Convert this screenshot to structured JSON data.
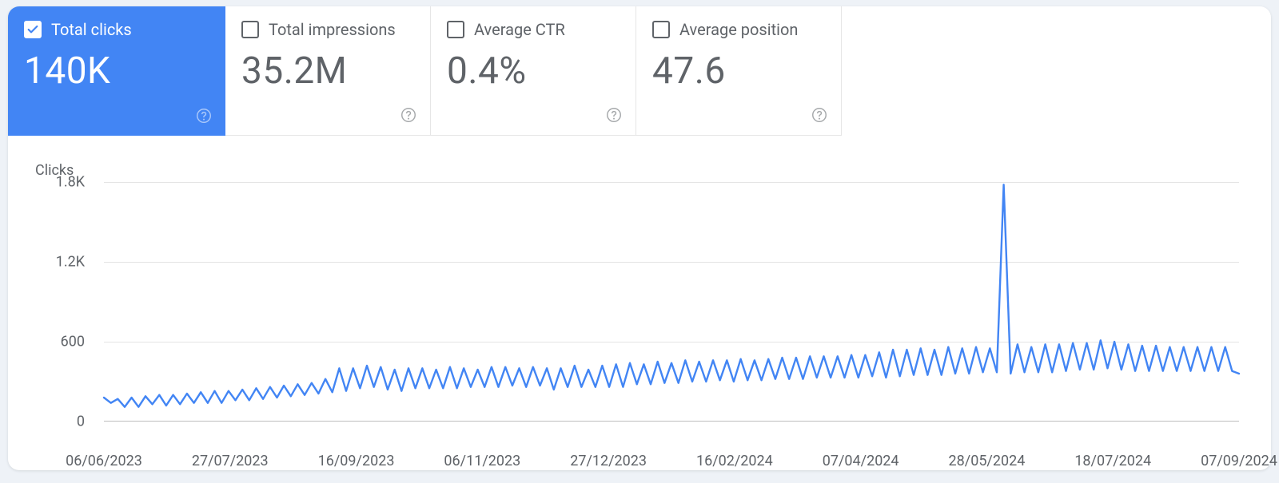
{
  "metrics": [
    {
      "label": "Total clicks",
      "value": "140K",
      "active": true
    },
    {
      "label": "Total impressions",
      "value": "35.2M",
      "active": false
    },
    {
      "label": "Average CTR",
      "value": "0.4%",
      "active": false
    },
    {
      "label": "Average position",
      "value": "47.6",
      "active": false
    }
  ],
  "chart_data": {
    "type": "line",
    "title": "Clicks",
    "ylabel": "",
    "ylim": [
      0,
      1800
    ],
    "y_ticks": [
      0,
      600,
      1200,
      1800
    ],
    "y_tick_labels": [
      "0",
      "600",
      "1.2K",
      "1.8K"
    ],
    "x_tick_labels": [
      "06/06/2023",
      "27/07/2023",
      "16/09/2023",
      "06/11/2023",
      "27/12/2023",
      "16/02/2024",
      "07/04/2024",
      "28/05/2024",
      "18/07/2024",
      "07/09/2024"
    ],
    "series": [
      {
        "name": "Clicks",
        "color": "#4285f4",
        "values": [
          180,
          140,
          170,
          110,
          180,
          110,
          190,
          130,
          200,
          120,
          200,
          130,
          210,
          140,
          220,
          140,
          230,
          140,
          230,
          160,
          240,
          160,
          250,
          170,
          260,
          180,
          270,
          190,
          280,
          200,
          290,
          210,
          320,
          220,
          400,
          230,
          400,
          250,
          420,
          260,
          410,
          240,
          390,
          230,
          400,
          250,
          400,
          250,
          390,
          250,
          410,
          250,
          400,
          260,
          390,
          260,
          410,
          260,
          410,
          270,
          400,
          260,
          410,
          270,
          400,
          240,
          400,
          260,
          420,
          260,
          390,
          260,
          420,
          260,
          430,
          260,
          440,
          280,
          430,
          280,
          450,
          290,
          440,
          290,
          460,
          300,
          450,
          300,
          460,
          310,
          460,
          300,
          470,
          310,
          460,
          310,
          470,
          320,
          480,
          320,
          480,
          320,
          490,
          330,
          490,
          330,
          490,
          330,
          500,
          330,
          500,
          340,
          520,
          330,
          540,
          340,
          540,
          350,
          550,
          350,
          540,
          350,
          560,
          360,
          550,
          360,
          560,
          370,
          550,
          370,
          1780,
          360,
          580,
          370,
          560,
          370,
          580,
          370,
          580,
          380,
          590,
          390,
          590,
          390,
          610,
          400,
          600,
          390,
          580,
          380,
          570,
          380,
          570,
          380,
          560,
          380,
          560,
          380,
          560,
          380,
          560,
          380,
          560,
          380,
          360
        ]
      }
    ]
  }
}
